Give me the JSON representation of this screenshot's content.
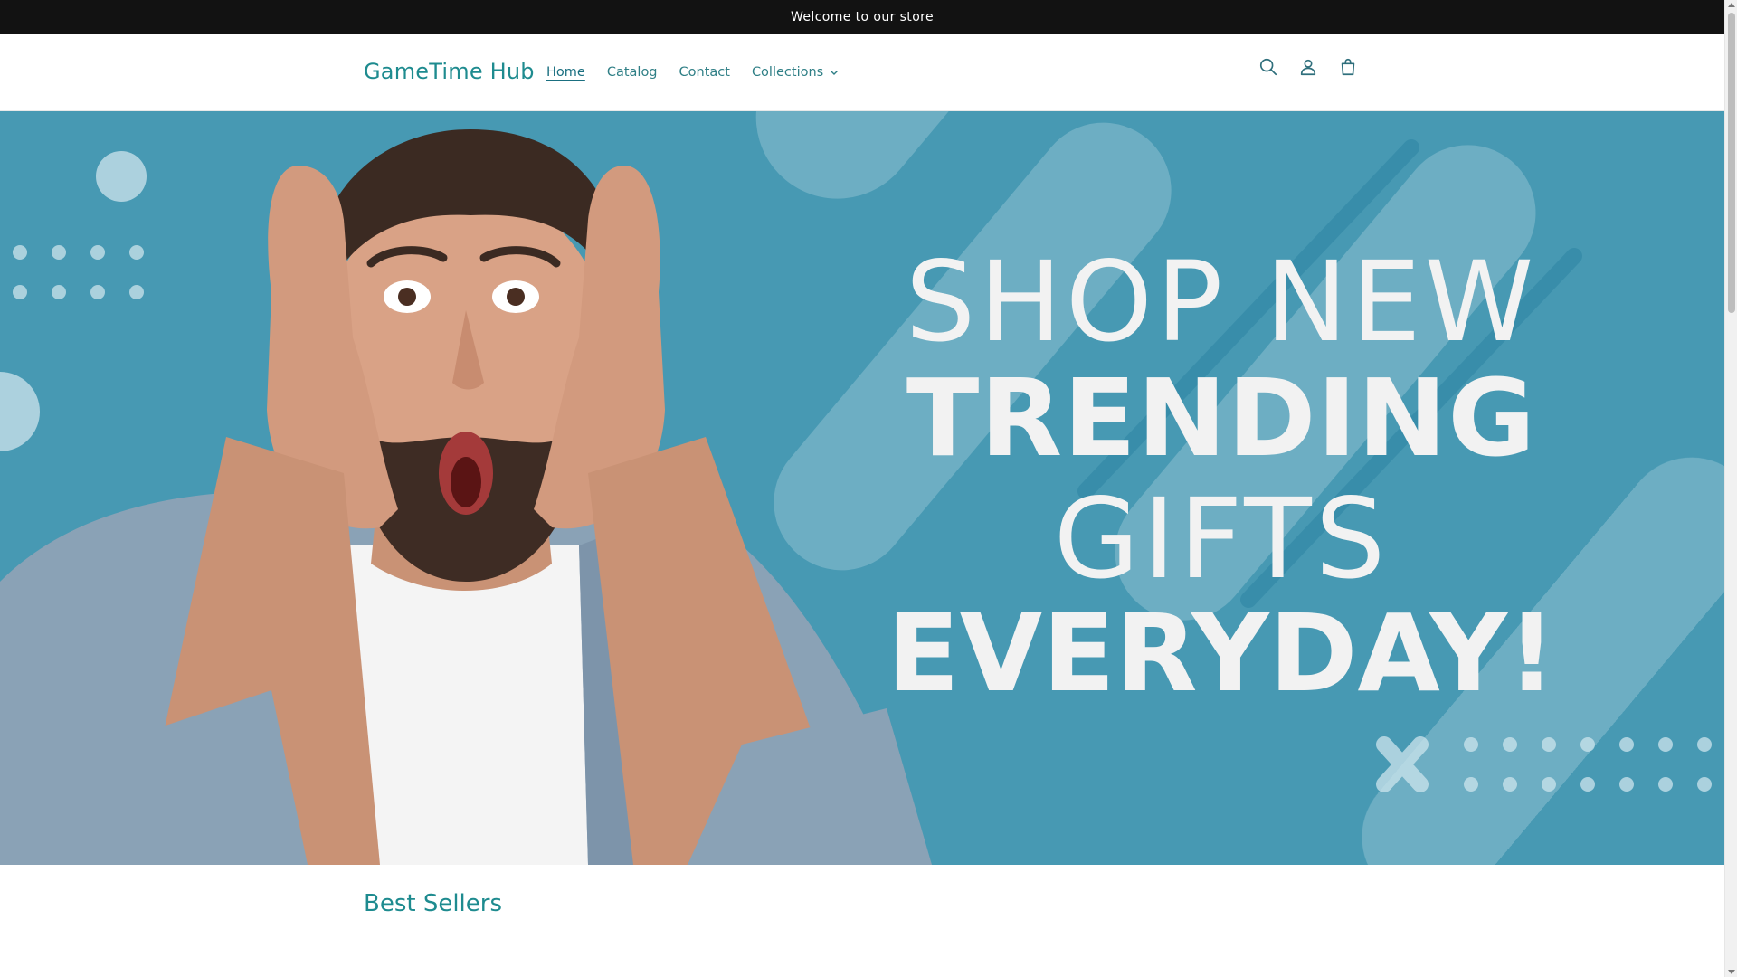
{
  "announcement": {
    "text": "Welcome to our store"
  },
  "header": {
    "logo": "GameTime Hub",
    "nav": [
      {
        "label": "Home",
        "active": true
      },
      {
        "label": "Catalog",
        "active": false
      },
      {
        "label": "Contact",
        "active": false
      },
      {
        "label": "Collections",
        "active": false,
        "dropdown": true
      }
    ],
    "icons": [
      "search-icon",
      "account-icon",
      "cart-icon"
    ]
  },
  "hero": {
    "line1": "SHOP NEW",
    "line2": "TRENDING",
    "line3": "GIFTS",
    "line4": "EVERYDAY!",
    "background_color": "#4799b3"
  },
  "section": {
    "title": "Best Sellers"
  },
  "colors": {
    "accent": "#1e8b8f",
    "announcement_bg": "#121212"
  }
}
